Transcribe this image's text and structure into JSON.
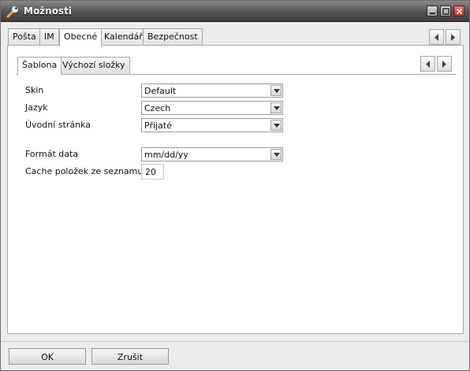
{
  "window": {
    "title": "Možnosti"
  },
  "tabs_outer": [
    "Pošta",
    "IM",
    "Obecné",
    "Kalendář",
    "Bezpečnost"
  ],
  "tabs_outer_active": "Obecné",
  "tabs_inner": [
    "Šablona",
    "Výchozí složky"
  ],
  "tabs_inner_active": "Šablona",
  "form": {
    "skin": {
      "label": "Skin",
      "value": "Default"
    },
    "language": {
      "label": "Jazyk",
      "value": "Czech"
    },
    "start_page": {
      "label": "Úvodní stránka",
      "value": "Přijaté"
    },
    "date_format": {
      "label": "Formát data",
      "value": "mm/dd/yy"
    },
    "cache": {
      "label": "Cache položek ze seznamu",
      "value": "20"
    }
  },
  "buttons": {
    "ok": "OK",
    "cancel": "Zrušit"
  },
  "colors": {
    "titlebar": "#525252",
    "close": "#c42a1d",
    "panel": "#ffffff",
    "background": "#ececec"
  }
}
